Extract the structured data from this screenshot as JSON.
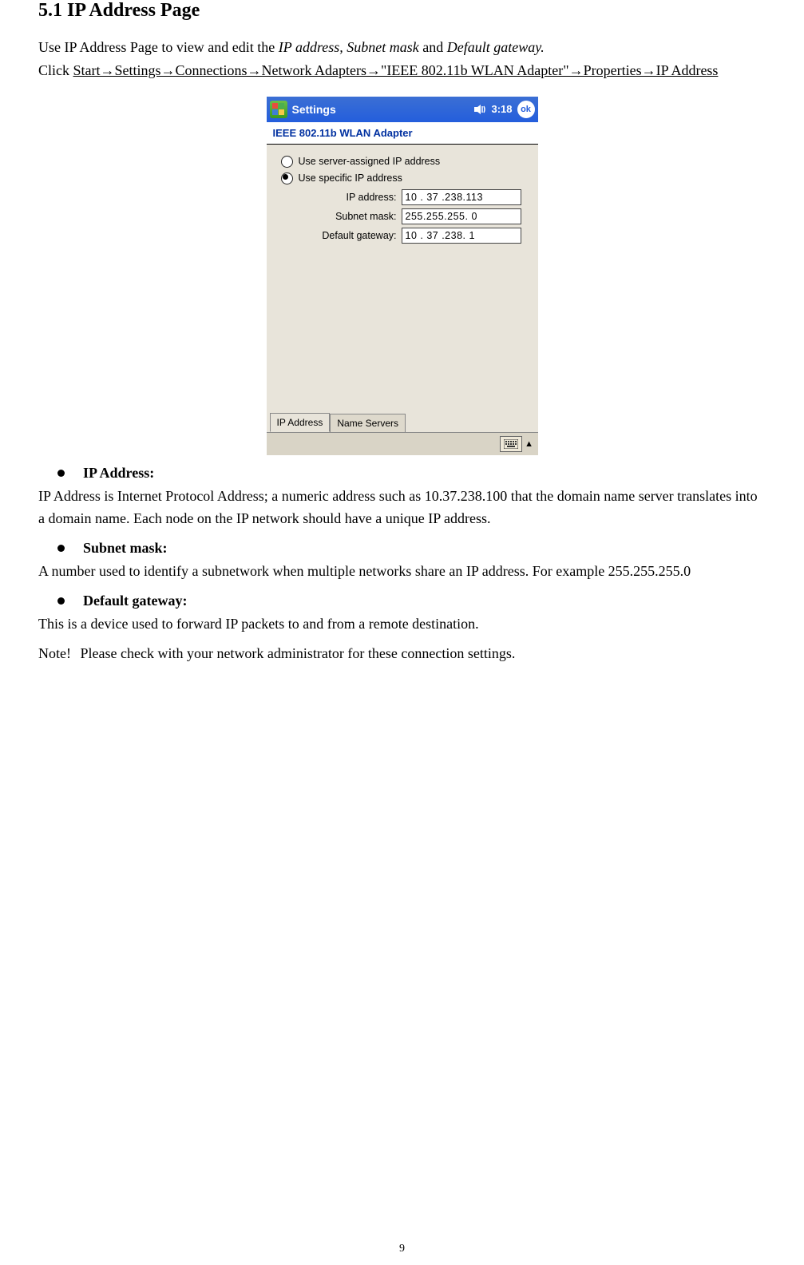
{
  "heading": "5.1 IP Address Page",
  "intro_prefix": "Use IP Address Page to view and edit the ",
  "intro_italic": "IP address, Subnet mask",
  "intro_mid": " and ",
  "intro_italic2": "Default gateway.",
  "click_prefix": "Click ",
  "path_part1": "Start→Settings→",
  "path_part2": "Connections→Network Adapters→\"IEEE 802.11b WLAN Adapter\"→Properties→IP Address",
  "screenshot": {
    "titlebar": {
      "title": "Settings",
      "time": "3:18",
      "ok": "ok"
    },
    "header": "IEEE 802.11b WLAN Adapter",
    "radio1": "Use server-assigned IP address",
    "radio2": "Use specific IP address",
    "fields": {
      "ip_label": "IP address:",
      "ip_value": "10 . 37 .238.113",
      "subnet_label": "Subnet mask:",
      "subnet_value": "255.255.255.  0",
      "gateway_label": "Default gateway:",
      "gateway_value": "10 . 37 .238.  1"
    },
    "tabs": {
      "tab1": "IP Address",
      "tab2": "Name Servers"
    }
  },
  "bullets": {
    "ip_title": "IP Address:",
    "ip_body": "IP Address is Internet Protocol Address; a numeric address such as 10.37.238.100 that the domain name server translates into a domain name. Each node on the IP network should have a unique IP address.",
    "subnet_title": "Subnet mask:",
    "subnet_body": "A number used to identify a subnetwork when multiple networks share an IP address. For example 255.255.255.0",
    "gateway_title": "Default gateway:",
    "gateway_body": "This is a device used to forward IP packets to and from a remote destination.",
    "note_label": "Note!",
    "note_body": "Please check with your network administrator for these connection settings."
  },
  "page_number": "9"
}
